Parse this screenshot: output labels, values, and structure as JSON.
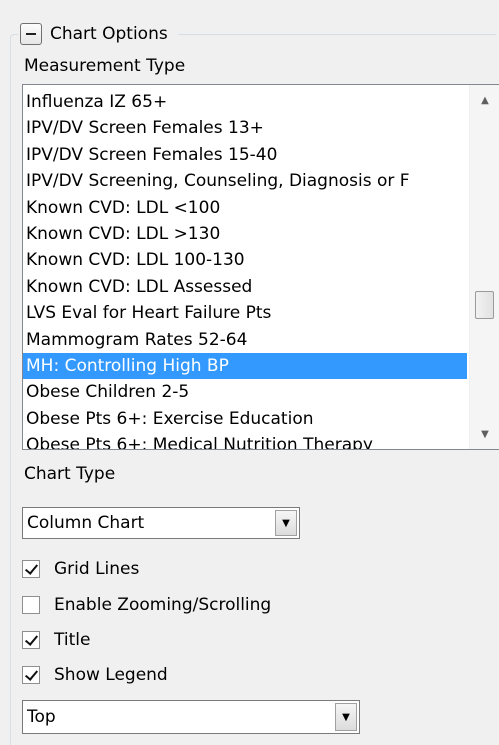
{
  "group": {
    "title": "Chart Options"
  },
  "measurement": {
    "label": "Measurement Type",
    "items": [
      "Influenza IZ 65+",
      "IPV/DV Screen Females 13+",
      "IPV/DV Screen Females 15-40",
      "IPV/DV Screening, Counseling, Diagnosis or F",
      "Known CVD: LDL <100",
      "Known CVD: LDL >130",
      "Known CVD: LDL 100-130",
      "Known CVD: LDL Assessed",
      "LVS Eval for Heart Failure Pts",
      "Mammogram Rates 52-64",
      "MH: Controlling High BP",
      "Obese Children 2-5",
      "Obese Pts 6+: Exercise Education",
      "Obese Pts 6+: Medical Nutrition Therapy"
    ],
    "selected_index": 10
  },
  "chart_type": {
    "label": "Chart Type",
    "value": "Column Chart"
  },
  "options": {
    "grid_lines": {
      "label": "Grid Lines",
      "checked": true
    },
    "zooming": {
      "label": "Enable Zooming/Scrolling",
      "checked": false
    },
    "title": {
      "label": "Title",
      "checked": true
    },
    "legend": {
      "label": "Show Legend",
      "checked": true
    }
  },
  "legend_position": {
    "value": "Top"
  },
  "icons": {
    "collapse": "minus-box-icon",
    "scroll_up": "triangle-up-icon",
    "scroll_down": "triangle-down-icon",
    "dropdown": "triangle-down-icon"
  },
  "colors": {
    "selection": "#3399ff",
    "background": "#f0f0f0"
  }
}
